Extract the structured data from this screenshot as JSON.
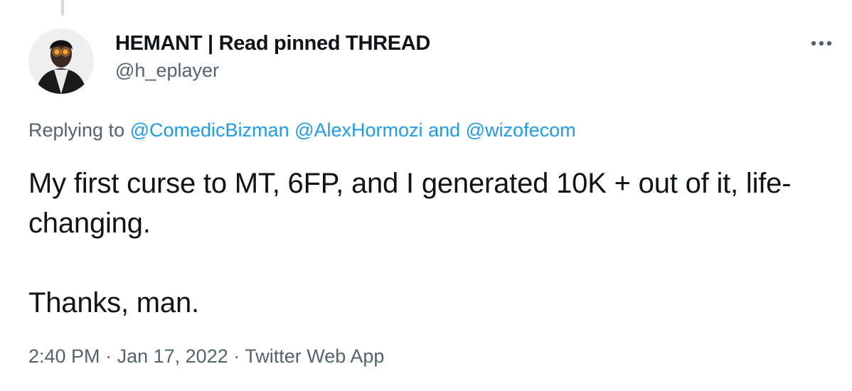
{
  "tweet": {
    "author": {
      "display_name": "HEMANT | Read pinned THREAD",
      "handle": "@h_eplayer",
      "avatar_icon": "user-avatar"
    },
    "more_icon": "more-horizontal-icon",
    "replying": {
      "prefix": "Replying to",
      "mention_1": "@ComedicBizman",
      "mention_2": "@AlexHormozi",
      "conjunction": "and",
      "mention_3": "@wizofecom"
    },
    "text": {
      "line_1": "My first curse to MT, 6FP, and I generated 10K + out of it, life-changing.",
      "line_2": "Thanks, man."
    },
    "meta": {
      "time": "2:40 PM",
      "separator": "·",
      "date": "Jan 17, 2022",
      "source": "Twitter Web App"
    }
  },
  "colors": {
    "text_primary": "#0f1419",
    "text_secondary": "#536471",
    "link": "#1d9bf0",
    "thread_line": "#cfd9de"
  }
}
